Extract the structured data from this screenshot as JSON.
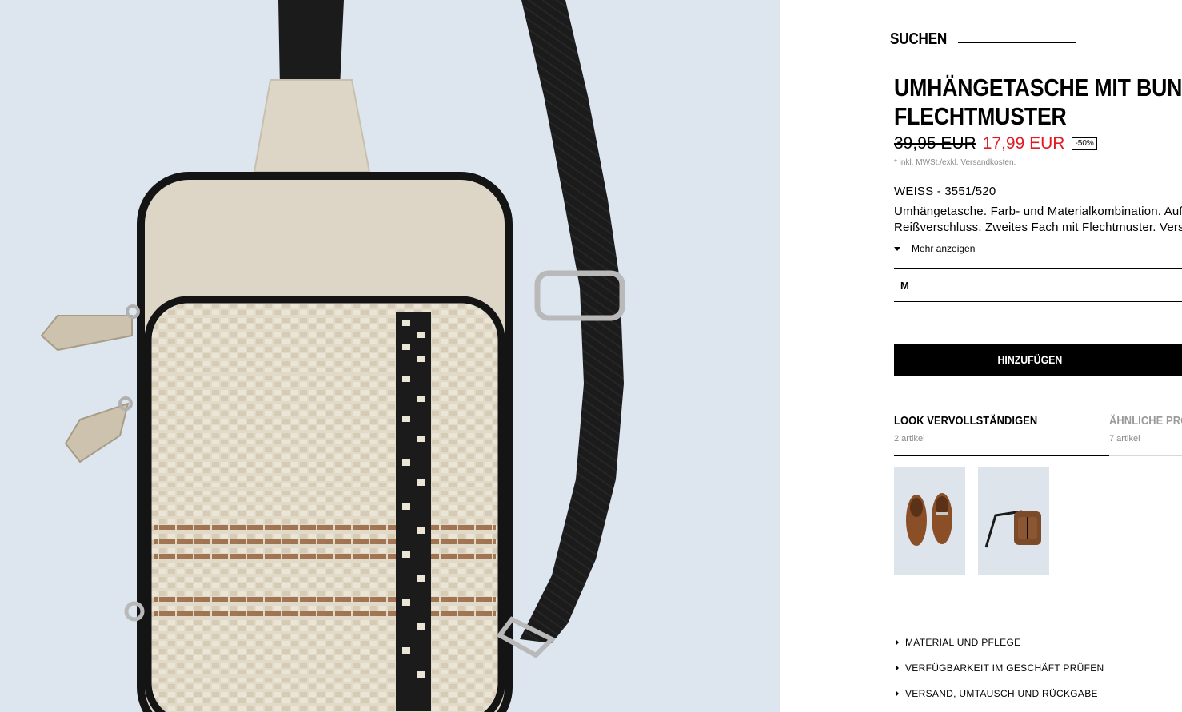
{
  "product_image": {
    "alt": "product-photo"
  },
  "header": {
    "search_label": "SUCHEN"
  },
  "product": {
    "title_line1": "UMHÄNGETASCHE MIT BUNTEM",
    "title_line2": "FLECHTMUSTER",
    "price_old": "39,95 EUR",
    "price_new": "17,99 EUR",
    "discount_badge": "-50%",
    "tax_note": "* inkl. MWSt./exkl. Versandkosten.",
    "color_ref": "WEISS - 3551/520",
    "description_line1": "Umhängetasche. Farb- und Materialkombination. Außenfach mit",
    "description_line2": "Reißverschluss. Zweites Fach mit Flechtmuster. Verstellbarer Riemen.",
    "more_label": "Mehr anzeigen",
    "size_selected": "M",
    "add_label": "HINZUFÜGEN"
  },
  "tabs": [
    {
      "label": "LOOK VERVOLLSTÄNDIGEN",
      "count": "2 artikel",
      "active": true
    },
    {
      "label": "ÄHNLICHE PRODUKTE",
      "count": "7 artikel",
      "active": false
    }
  ],
  "thumbnails": [
    {
      "icon": "loafer-shoes-thumbnail"
    },
    {
      "icon": "brown-crossbody-bag-thumbnail"
    }
  ],
  "accordion": [
    "MATERIAL UND PFLEGE",
    "VERFÜGBARKEIT IM GESCHÄFT PRÜFEN",
    "VERSAND, UMTAUSCH UND RÜCKGABE"
  ],
  "colors": {
    "sale_red": "#e01b22",
    "button_bg": "#000000",
    "image_bg": "#dde6ef",
    "bag_cream": "#ddd6c6"
  }
}
